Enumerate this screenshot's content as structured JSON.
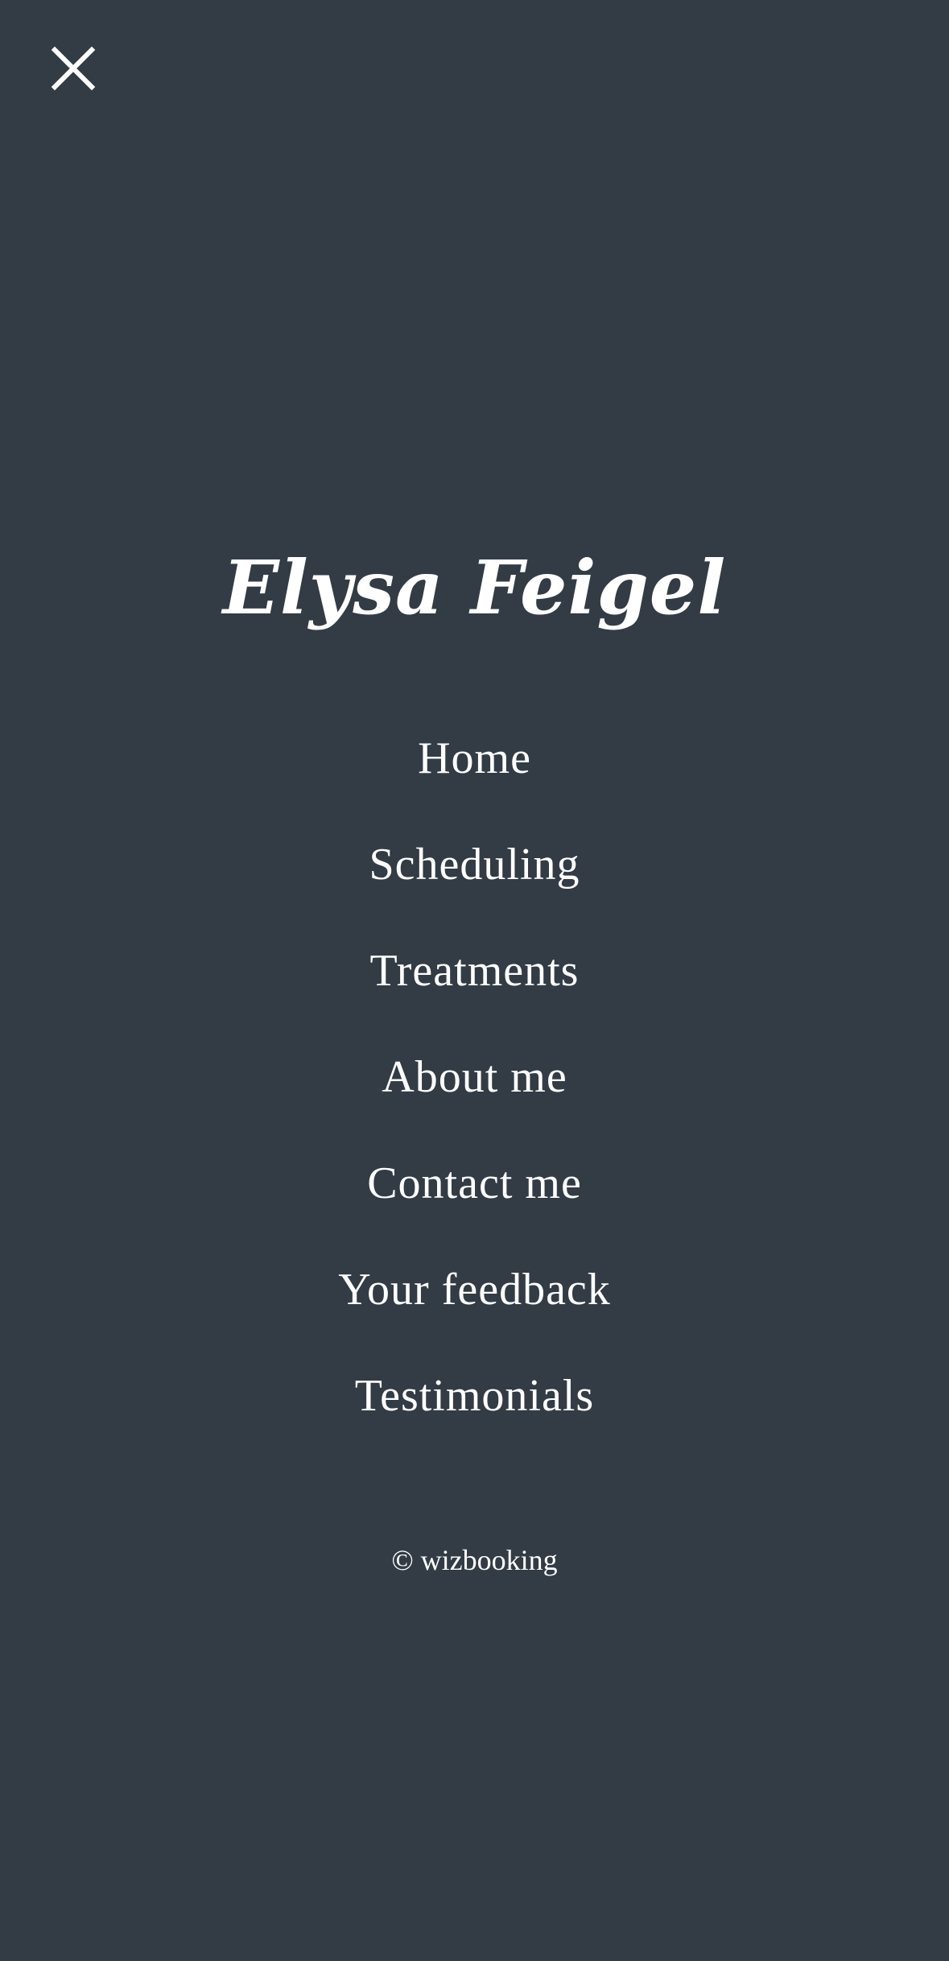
{
  "menu": {
    "close_icon": "close-icon",
    "brand": "Elysa Feigel",
    "items": [
      {
        "label": "Home"
      },
      {
        "label": "Scheduling"
      },
      {
        "label": "Treatments"
      },
      {
        "label": "About me"
      },
      {
        "label": "Contact me"
      },
      {
        "label": "Your feedback"
      },
      {
        "label": "Testimonials"
      }
    ],
    "footer": "© wizbooking"
  },
  "colors": {
    "background": "#333c45",
    "text": "#ffffff"
  }
}
